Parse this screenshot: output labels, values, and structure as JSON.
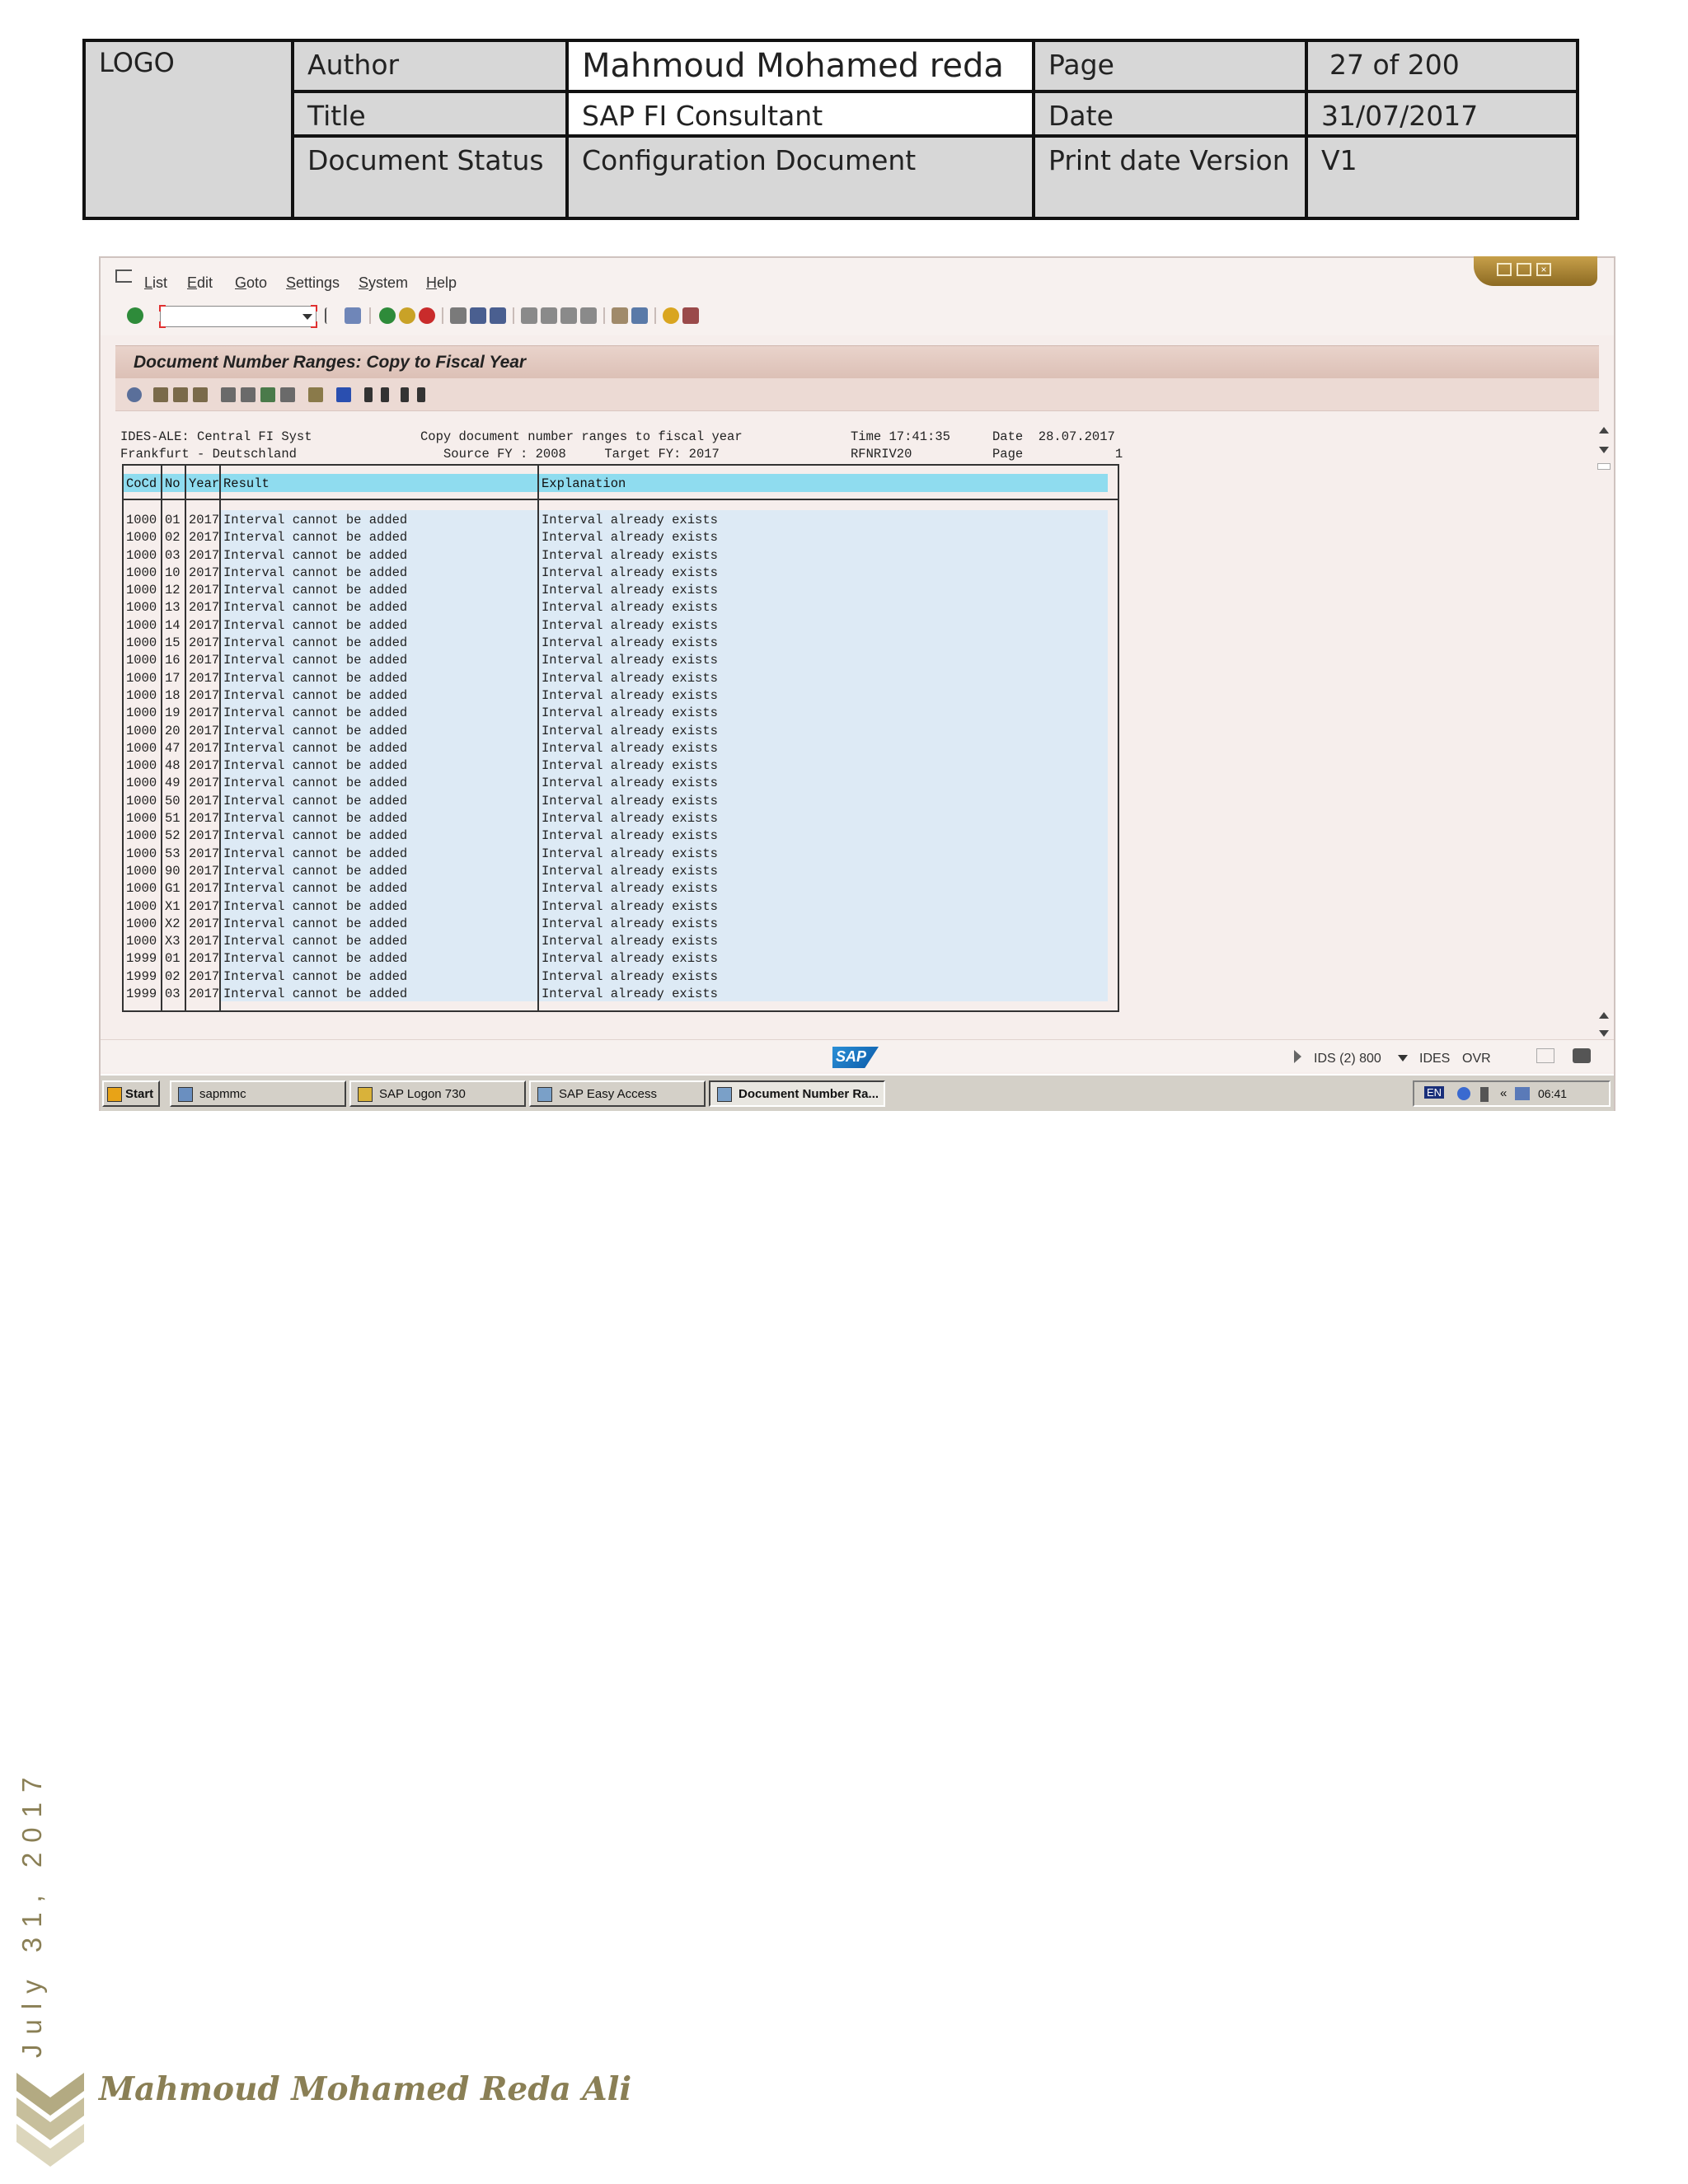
{
  "doc_header": {
    "logo": "LOGO",
    "author_label": "Author",
    "author_value": "Mahmoud Mohamed reda",
    "page_label": "Page",
    "page_value": "27 of 200",
    "title_label": "Title",
    "title_value": "SAP FI Consultant",
    "date_label": "Date",
    "date_value": "31/07/2017",
    "status_label": "Document Status",
    "status_value": "Configuration Document",
    "print_label": "Print date Version",
    "print_value": "V1"
  },
  "sap": {
    "menu": [
      "List",
      "Edit",
      "Goto",
      "Settings",
      "System",
      "Help"
    ],
    "command_value": "",
    "screen_title": "Document Number Ranges: Copy to Fiscal Year",
    "report_header": {
      "line1_left": "IDES-ALE: Central FI Syst",
      "line1_mid": "Copy document number ranges to fiscal year",
      "line1_time": "Time 17:41:35",
      "line1_date": "Date  28.07.2017",
      "line2_left": "Frankfurt - Deutschland",
      "line2_mid": "Source FY : 2008     Target FY: 2017",
      "line2_prog": "RFNRIV20",
      "line2_page": "Page            1"
    },
    "table": {
      "columns": [
        "CoCd",
        "No",
        "Year",
        "Result",
        "Explanation"
      ],
      "rows": [
        [
          "1000",
          "01",
          "2017",
          "Interval cannot be added",
          "Interval already exists"
        ],
        [
          "1000",
          "02",
          "2017",
          "Interval cannot be added",
          "Interval already exists"
        ],
        [
          "1000",
          "03",
          "2017",
          "Interval cannot be added",
          "Interval already exists"
        ],
        [
          "1000",
          "10",
          "2017",
          "Interval cannot be added",
          "Interval already exists"
        ],
        [
          "1000",
          "12",
          "2017",
          "Interval cannot be added",
          "Interval already exists"
        ],
        [
          "1000",
          "13",
          "2017",
          "Interval cannot be added",
          "Interval already exists"
        ],
        [
          "1000",
          "14",
          "2017",
          "Interval cannot be added",
          "Interval already exists"
        ],
        [
          "1000",
          "15",
          "2017",
          "Interval cannot be added",
          "Interval already exists"
        ],
        [
          "1000",
          "16",
          "2017",
          "Interval cannot be added",
          "Interval already exists"
        ],
        [
          "1000",
          "17",
          "2017",
          "Interval cannot be added",
          "Interval already exists"
        ],
        [
          "1000",
          "18",
          "2017",
          "Interval cannot be added",
          "Interval already exists"
        ],
        [
          "1000",
          "19",
          "2017",
          "Interval cannot be added",
          "Interval already exists"
        ],
        [
          "1000",
          "20",
          "2017",
          "Interval cannot be added",
          "Interval already exists"
        ],
        [
          "1000",
          "47",
          "2017",
          "Interval cannot be added",
          "Interval already exists"
        ],
        [
          "1000",
          "48",
          "2017",
          "Interval cannot be added",
          "Interval already exists"
        ],
        [
          "1000",
          "49",
          "2017",
          "Interval cannot be added",
          "Interval already exists"
        ],
        [
          "1000",
          "50",
          "2017",
          "Interval cannot be added",
          "Interval already exists"
        ],
        [
          "1000",
          "51",
          "2017",
          "Interval cannot be added",
          "Interval already exists"
        ],
        [
          "1000",
          "52",
          "2017",
          "Interval cannot be added",
          "Interval already exists"
        ],
        [
          "1000",
          "53",
          "2017",
          "Interval cannot be added",
          "Interval already exists"
        ],
        [
          "1000",
          "90",
          "2017",
          "Interval cannot be added",
          "Interval already exists"
        ],
        [
          "1000",
          "G1",
          "2017",
          "Interval cannot be added",
          "Interval already exists"
        ],
        [
          "1000",
          "X1",
          "2017",
          "Interval cannot be added",
          "Interval already exists"
        ],
        [
          "1000",
          "X2",
          "2017",
          "Interval cannot be added",
          "Interval already exists"
        ],
        [
          "1000",
          "X3",
          "2017",
          "Interval cannot be added",
          "Interval already exists"
        ],
        [
          "1999",
          "01",
          "2017",
          "Interval cannot be added",
          "Interval already exists"
        ],
        [
          "1999",
          "02",
          "2017",
          "Interval cannot be added",
          "Interval already exists"
        ],
        [
          "1999",
          "03",
          "2017",
          "Interval cannot be added",
          "Interval already exists"
        ]
      ]
    },
    "status": {
      "logo": "SAP",
      "system": "IDS (2) 800",
      "server": "IDES",
      "mode": "OVR"
    },
    "taskbar": {
      "start": "Start",
      "items": [
        "sapmmc",
        "SAP Logon 730",
        "SAP Easy Access",
        "Document Number Ra..."
      ],
      "lang": "EN",
      "clock": "06:41"
    }
  },
  "footer": {
    "date": "July 31, 2017",
    "author": "Mahmoud Mohamed Reda Ali"
  },
  "colors": {
    "header_cell": "#d7d7d7",
    "sap_bg": "#f6eeec",
    "grid_header": "#8fdcef",
    "row_band": "#ddeaf5",
    "footer_gold": "#8a7f55"
  }
}
